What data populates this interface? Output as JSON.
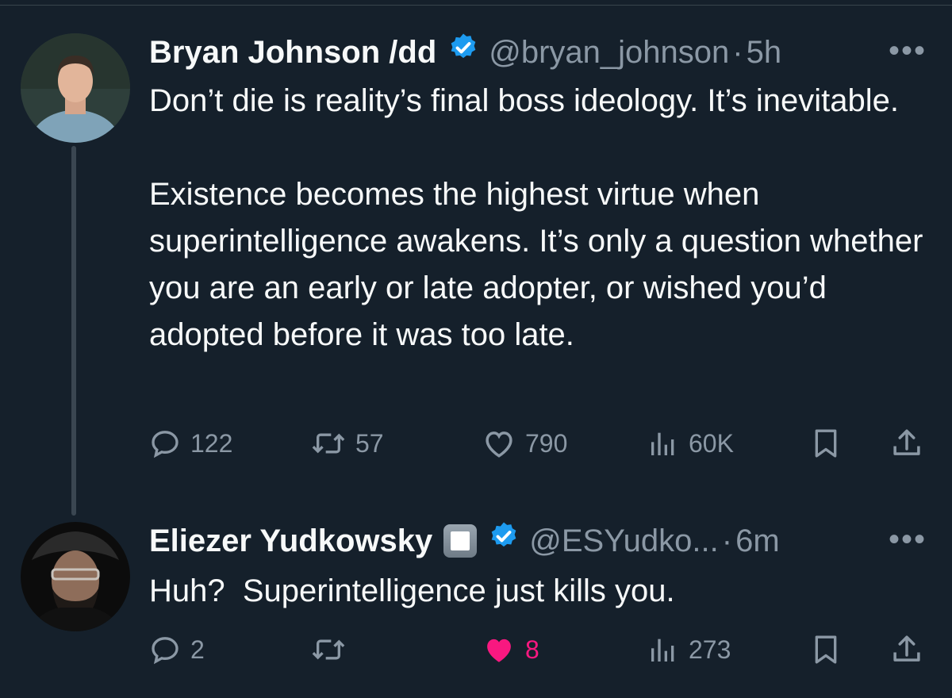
{
  "colors": {
    "background": "#15202b",
    "text": "#f7f9f9",
    "muted": "#8b98a5",
    "verified": "#1d9bf0",
    "like_active": "#f91880"
  },
  "tweets": [
    {
      "display_name": "Bryan Johnson /dd",
      "handle": "@bryan_johnson",
      "separator": "·",
      "time": "5h",
      "more": "•••",
      "paragraphs": [
        "Don’t die is reality’s final boss ideology. It’s inevitable.",
        "Existence becomes the highest virtue when superintelligence awakens. It’s only a question whether you are an early or late adopter, or wished you’d adopted before it was too late."
      ],
      "replies": "122",
      "reposts": "57",
      "likes": "790",
      "views": "60K",
      "icons": [
        "reply-icon",
        "repost-icon",
        "like-icon",
        "views-icon",
        "bookmark-icon",
        "share-icon"
      ]
    },
    {
      "display_name": "Eliezer Yudkowsky",
      "handle": "@ESYudko...",
      "separator": "·",
      "time": "6m",
      "more": "•••",
      "paragraphs": [
        "Huh?  Superintelligence just kills you."
      ],
      "replies": "2",
      "reposts": "",
      "likes": "8",
      "liked": true,
      "views": "273",
      "icons": [
        "reply-icon",
        "repost-icon",
        "like-icon-filled",
        "views-icon",
        "bookmark-icon",
        "share-icon"
      ]
    }
  ]
}
